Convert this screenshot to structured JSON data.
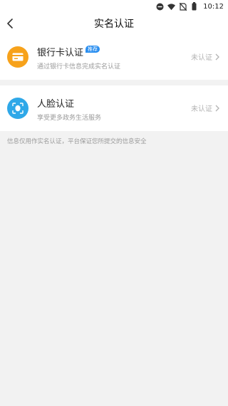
{
  "status_bar": {
    "time": "10:12",
    "icons": [
      "dnd-icon",
      "wifi-icon",
      "no-sim-icon",
      "battery-icon"
    ]
  },
  "header": {
    "title": "实名认证",
    "back_icon": "chevron-left-icon"
  },
  "items": [
    {
      "title": "银行卡认证",
      "badge": "推荐",
      "subtitle": "通过银行卡信息完成实名认证",
      "status": "未认证",
      "icon": "bank-card-icon",
      "icon_color": "#f7a21b"
    },
    {
      "title": "人脸认证",
      "subtitle": "享受更多政务生活服务",
      "status": "未认证",
      "icon": "face-scan-icon",
      "icon_color": "#2fa8e8"
    }
  ],
  "footnote": "信息仅用作实名认证，平台保证您所提交的信息安全",
  "colors": {
    "badge": "#2b8ff0",
    "background": "#f2f2f2",
    "muted_text": "#9a9a9a"
  }
}
